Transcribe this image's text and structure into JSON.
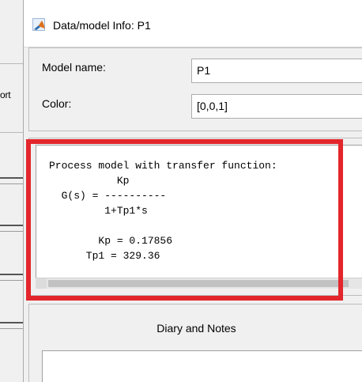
{
  "background": {
    "tab_label": "ort"
  },
  "dialog": {
    "title": "Data/model Info: P1",
    "title_icon": "matlab-icon",
    "model_name_label": "Model name:",
    "model_name_value": "P1",
    "color_label": "Color:",
    "color_value": "[0,0,1]",
    "model_text": "Process model with transfer function:\n           Kp\n  G(s) = ----------\n         1+Tp1*s\n\n        Kp = 0.17856\n      Tp1 = 329.36",
    "diary_title": "Diary and Notes",
    "diary_text": ""
  },
  "colors": {
    "highlight": "#e3262c",
    "window_bg": "#f0f0f0"
  }
}
